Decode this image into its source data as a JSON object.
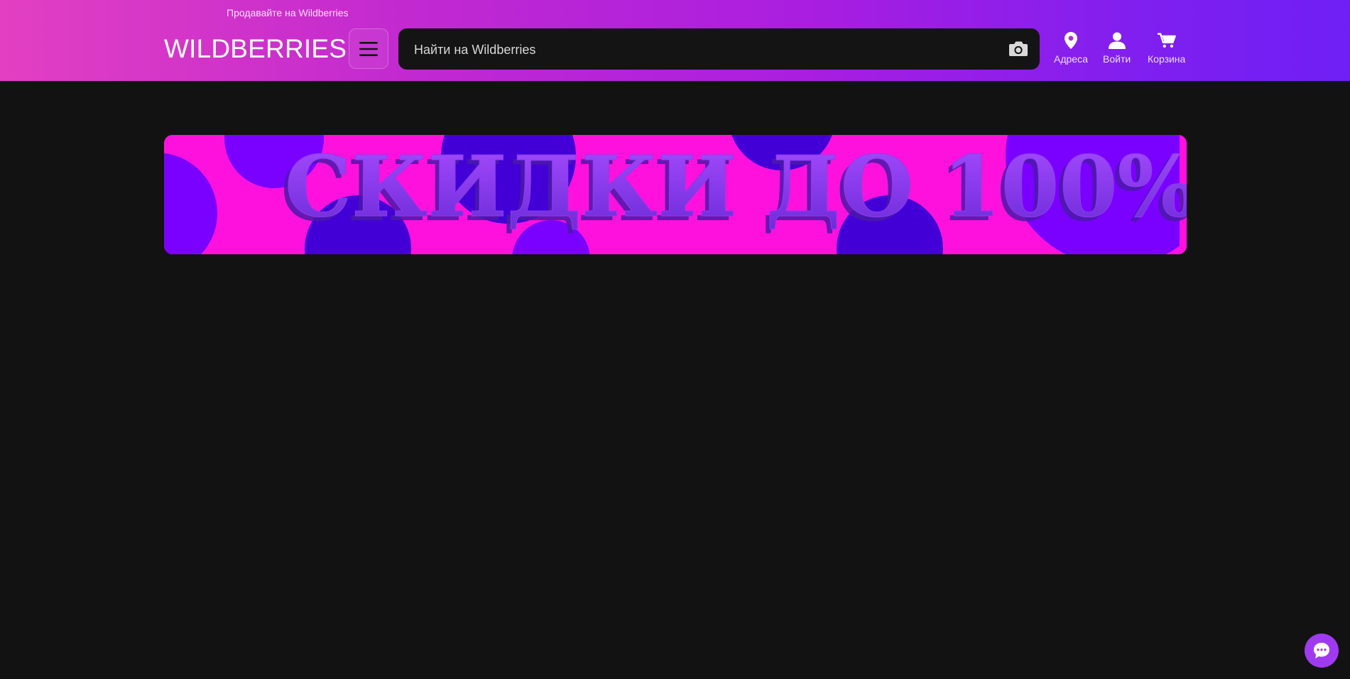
{
  "header": {
    "sell_link": "Продавайте на Wildberries",
    "logo": "WILDBERRIES",
    "menu_icon": "hamburger-menu-icon",
    "search": {
      "placeholder": "Найти на Wildberries",
      "value": "",
      "camera_icon": "camera-icon"
    },
    "nav": [
      {
        "label": "Адреса",
        "icon": "location-pin-icon"
      },
      {
        "label": "Войти",
        "icon": "user-icon"
      },
      {
        "label": "Корзина",
        "icon": "cart-icon"
      }
    ]
  },
  "banner": {
    "text": "СКИДКИ ДО 100%"
  },
  "chat": {
    "icon": "chat-bubble-icon"
  },
  "colors": {
    "background": "#121212",
    "header_gradient_start": "#e23fc2",
    "header_gradient_end": "#6f1ff5",
    "search_background": "#141414",
    "banner_pink": "#ff11dd",
    "banner_violet": "#7a00ff",
    "banner_dark_violet": "#4300d6",
    "chat_button": "#a03af0"
  }
}
